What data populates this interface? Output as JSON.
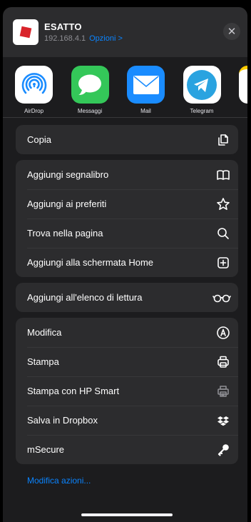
{
  "header": {
    "title": "ESATTO",
    "address": "192.168.4.1",
    "options_label": "Opzioni >",
    "close_label": "✕"
  },
  "apps": [
    {
      "label": "AirDrop",
      "icon": "airdrop-icon",
      "color": "#ffffff"
    },
    {
      "label": "Messaggi",
      "icon": "messages-icon",
      "color": "#34c759"
    },
    {
      "label": "Mail",
      "icon": "mail-icon",
      "color": "#1a8cff"
    },
    {
      "label": "Telegram",
      "icon": "telegram-icon",
      "color": "#ffffff"
    }
  ],
  "groups": [
    [
      {
        "label": "Copia",
        "icon": "copy-icon"
      }
    ],
    [
      {
        "label": "Aggiungi segnalibro",
        "icon": "book-icon"
      },
      {
        "label": "Aggiungi ai preferiti",
        "icon": "star-icon"
      },
      {
        "label": "Trova nella pagina",
        "icon": "search-icon"
      },
      {
        "label": "Aggiungi alla schermata Home",
        "icon": "add-square-icon"
      }
    ],
    [
      {
        "label": "Aggiungi all'elenco di lettura",
        "icon": "glasses-icon"
      }
    ],
    [
      {
        "label": "Modifica",
        "icon": "markup-icon"
      },
      {
        "label": "Stampa",
        "icon": "printer-icon"
      },
      {
        "label": "Stampa con HP Smart",
        "icon": "hp-printer-icon"
      },
      {
        "label": "Salva in Dropbox",
        "icon": "dropbox-icon"
      },
      {
        "label": "mSecure",
        "icon": "key-icon"
      }
    ]
  ],
  "footer": {
    "edit_actions_label": "Modifica azioni..."
  }
}
